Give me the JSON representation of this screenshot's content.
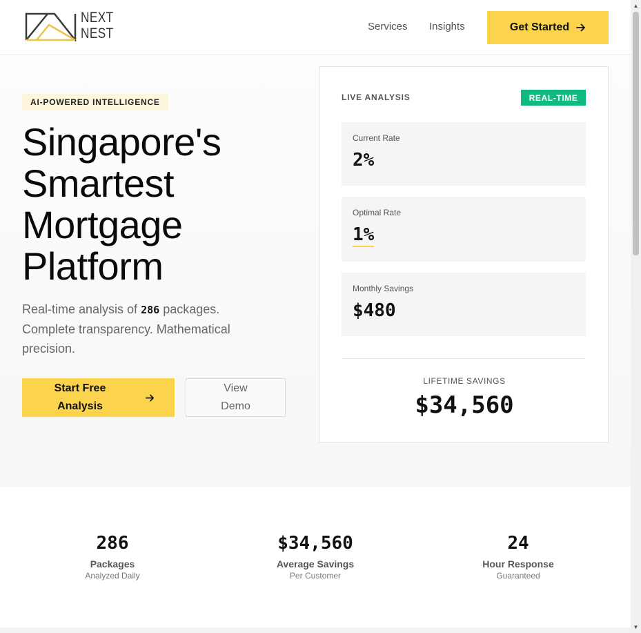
{
  "header": {
    "logo_line1": "NEXT",
    "logo_line2": "NEST",
    "nav": [
      {
        "label": "Services"
      },
      {
        "label": "Insights"
      }
    ],
    "cta_label": "Get Started",
    "cta_icon": "arrow-right-icon"
  },
  "hero": {
    "badge": "AI-POWERED INTELLIGENCE",
    "title_lines": [
      "Singapore's",
      "Smartest",
      "Mortgage",
      "Platform"
    ],
    "subtitle_before": "Real-time analysis of",
    "subtitle_number": "286",
    "subtitle_after": "packages. Complete transparency. Mathematical precision.",
    "primary_cta_label": "Start Free Analysis",
    "secondary_cta_label": "View Demo"
  },
  "analysis": {
    "heading": "LIVE ANALYSIS",
    "badge": "REAL-TIME",
    "metrics": [
      {
        "label": "Current Rate",
        "value": "2%"
      },
      {
        "label": "Optimal Rate",
        "value": "1%"
      },
      {
        "label": "Monthly Savings",
        "value": "$480"
      }
    ],
    "lifetime_label": "LIFETIME SAVINGS",
    "lifetime_value": "$34,560"
  },
  "stats": [
    {
      "value": "286",
      "label": "Packages",
      "sub": "Analyzed Daily"
    },
    {
      "value": "$34,560",
      "label": "Average Savings",
      "sub": "Per Customer"
    },
    {
      "value": "24",
      "label": "Hour Response",
      "sub": "Guaranteed"
    }
  ],
  "colors": {
    "accent": "#fcd34d",
    "realtime_badge": "#10b981",
    "badge_bg": "#fdf5dc"
  }
}
